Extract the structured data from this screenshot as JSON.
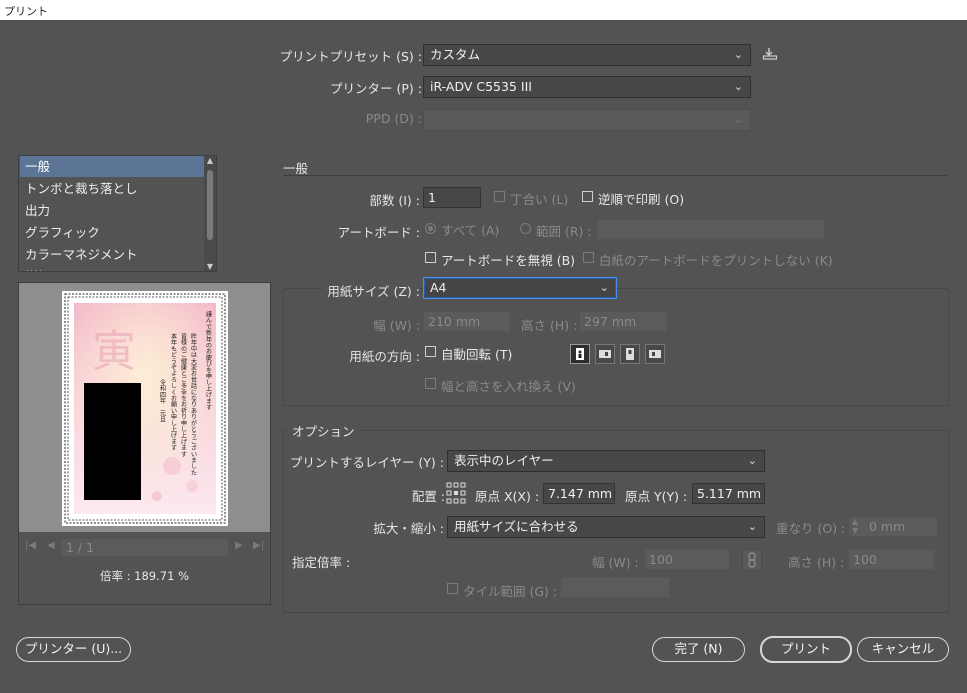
{
  "window": {
    "title": "プリント"
  },
  "header": {
    "preset_label": "プリントプリセット (S) :",
    "preset_value": "カスタム",
    "printer_label": "プリンター (P) :",
    "printer_value": "iR-ADV C5535 III",
    "ppd_label": "PPD (D) :",
    "ppd_value": ""
  },
  "sidebar": {
    "items": [
      {
        "label": "一般"
      },
      {
        "label": "トンボと裁ち落とし"
      },
      {
        "label": "出力"
      },
      {
        "label": "グラフィック"
      },
      {
        "label": "カラーマネジメント"
      },
      {
        "label": "詳細"
      }
    ],
    "active_index": 0
  },
  "preview": {
    "page_indicator": "1 / 1",
    "zoom_text": "倍率 : 189.71 %",
    "card_text": [
      "謹んで新年のお慶びを申し上げます",
      "昨年中は大変お世話になりありがとうございました",
      "皆様のご健康とご多幸をお祈り申し上げます",
      "本年もどうぞよろしくお願い申し上げます",
      "令和四年　元旦"
    ]
  },
  "general": {
    "section_title": "一般",
    "copies_label": "部数 (I) :",
    "copies_value": "1",
    "collate_label": "丁合い (L)",
    "reverse_label": "逆順で印刷 (O)",
    "artboard_label": "アートボード :",
    "all_label": "すべて (A)",
    "range_label": "範囲 (R) :",
    "range_value": "",
    "ignore_artboards_label": "アートボードを無視 (B)",
    "skip_blank_label": "白紙のアートボードをプリントしない (K)"
  },
  "media": {
    "size_label": "用紙サイズ (Z) :",
    "size_value": "A4",
    "width_label": "幅 (W) :",
    "width_value": "210 mm",
    "height_label": "高さ (H) :",
    "height_value": "297 mm",
    "orientation_label": "用紙の方向 :",
    "auto_rotate_label": "自動回転 (T)",
    "transverse_label": "幅と高さを入れ換え (V)"
  },
  "options": {
    "section_title": "オプション",
    "layers_label": "プリントするレイヤー (Y) :",
    "layers_value": "表示中のレイヤー",
    "placement_label": "配置 :",
    "origin_x_label": "原点 X(X) :",
    "origin_x_value": "7.147 mm",
    "origin_y_label": "原点 Y(Y) :",
    "origin_y_value": "5.117 mm",
    "scaling_label": "拡大・縮小 :",
    "scaling_value": "用紙サイズに合わせる",
    "overlap_label": "重なり (O) :",
    "overlap_value": "0 mm",
    "custom_scale_label": "指定倍率 :",
    "scale_w_label": "幅 (W) :",
    "scale_w_value": "100",
    "scale_h_label": "高さ (H) :",
    "scale_h_value": "100",
    "tile_label": "タイル範囲 (G) :",
    "tile_value": ""
  },
  "footer": {
    "printer_button": "プリンター (U)...",
    "done_button": "完了 (N)",
    "print_button": "プリント",
    "cancel_button": "キャンセル"
  },
  "icons": {
    "save_preset": "save-preset-icon",
    "link": "link-icon",
    "reference_point": "reference-point-icon"
  },
  "colors": {
    "background": "#535353",
    "selection": "#5c7596",
    "focus": "#4a8ee8"
  }
}
